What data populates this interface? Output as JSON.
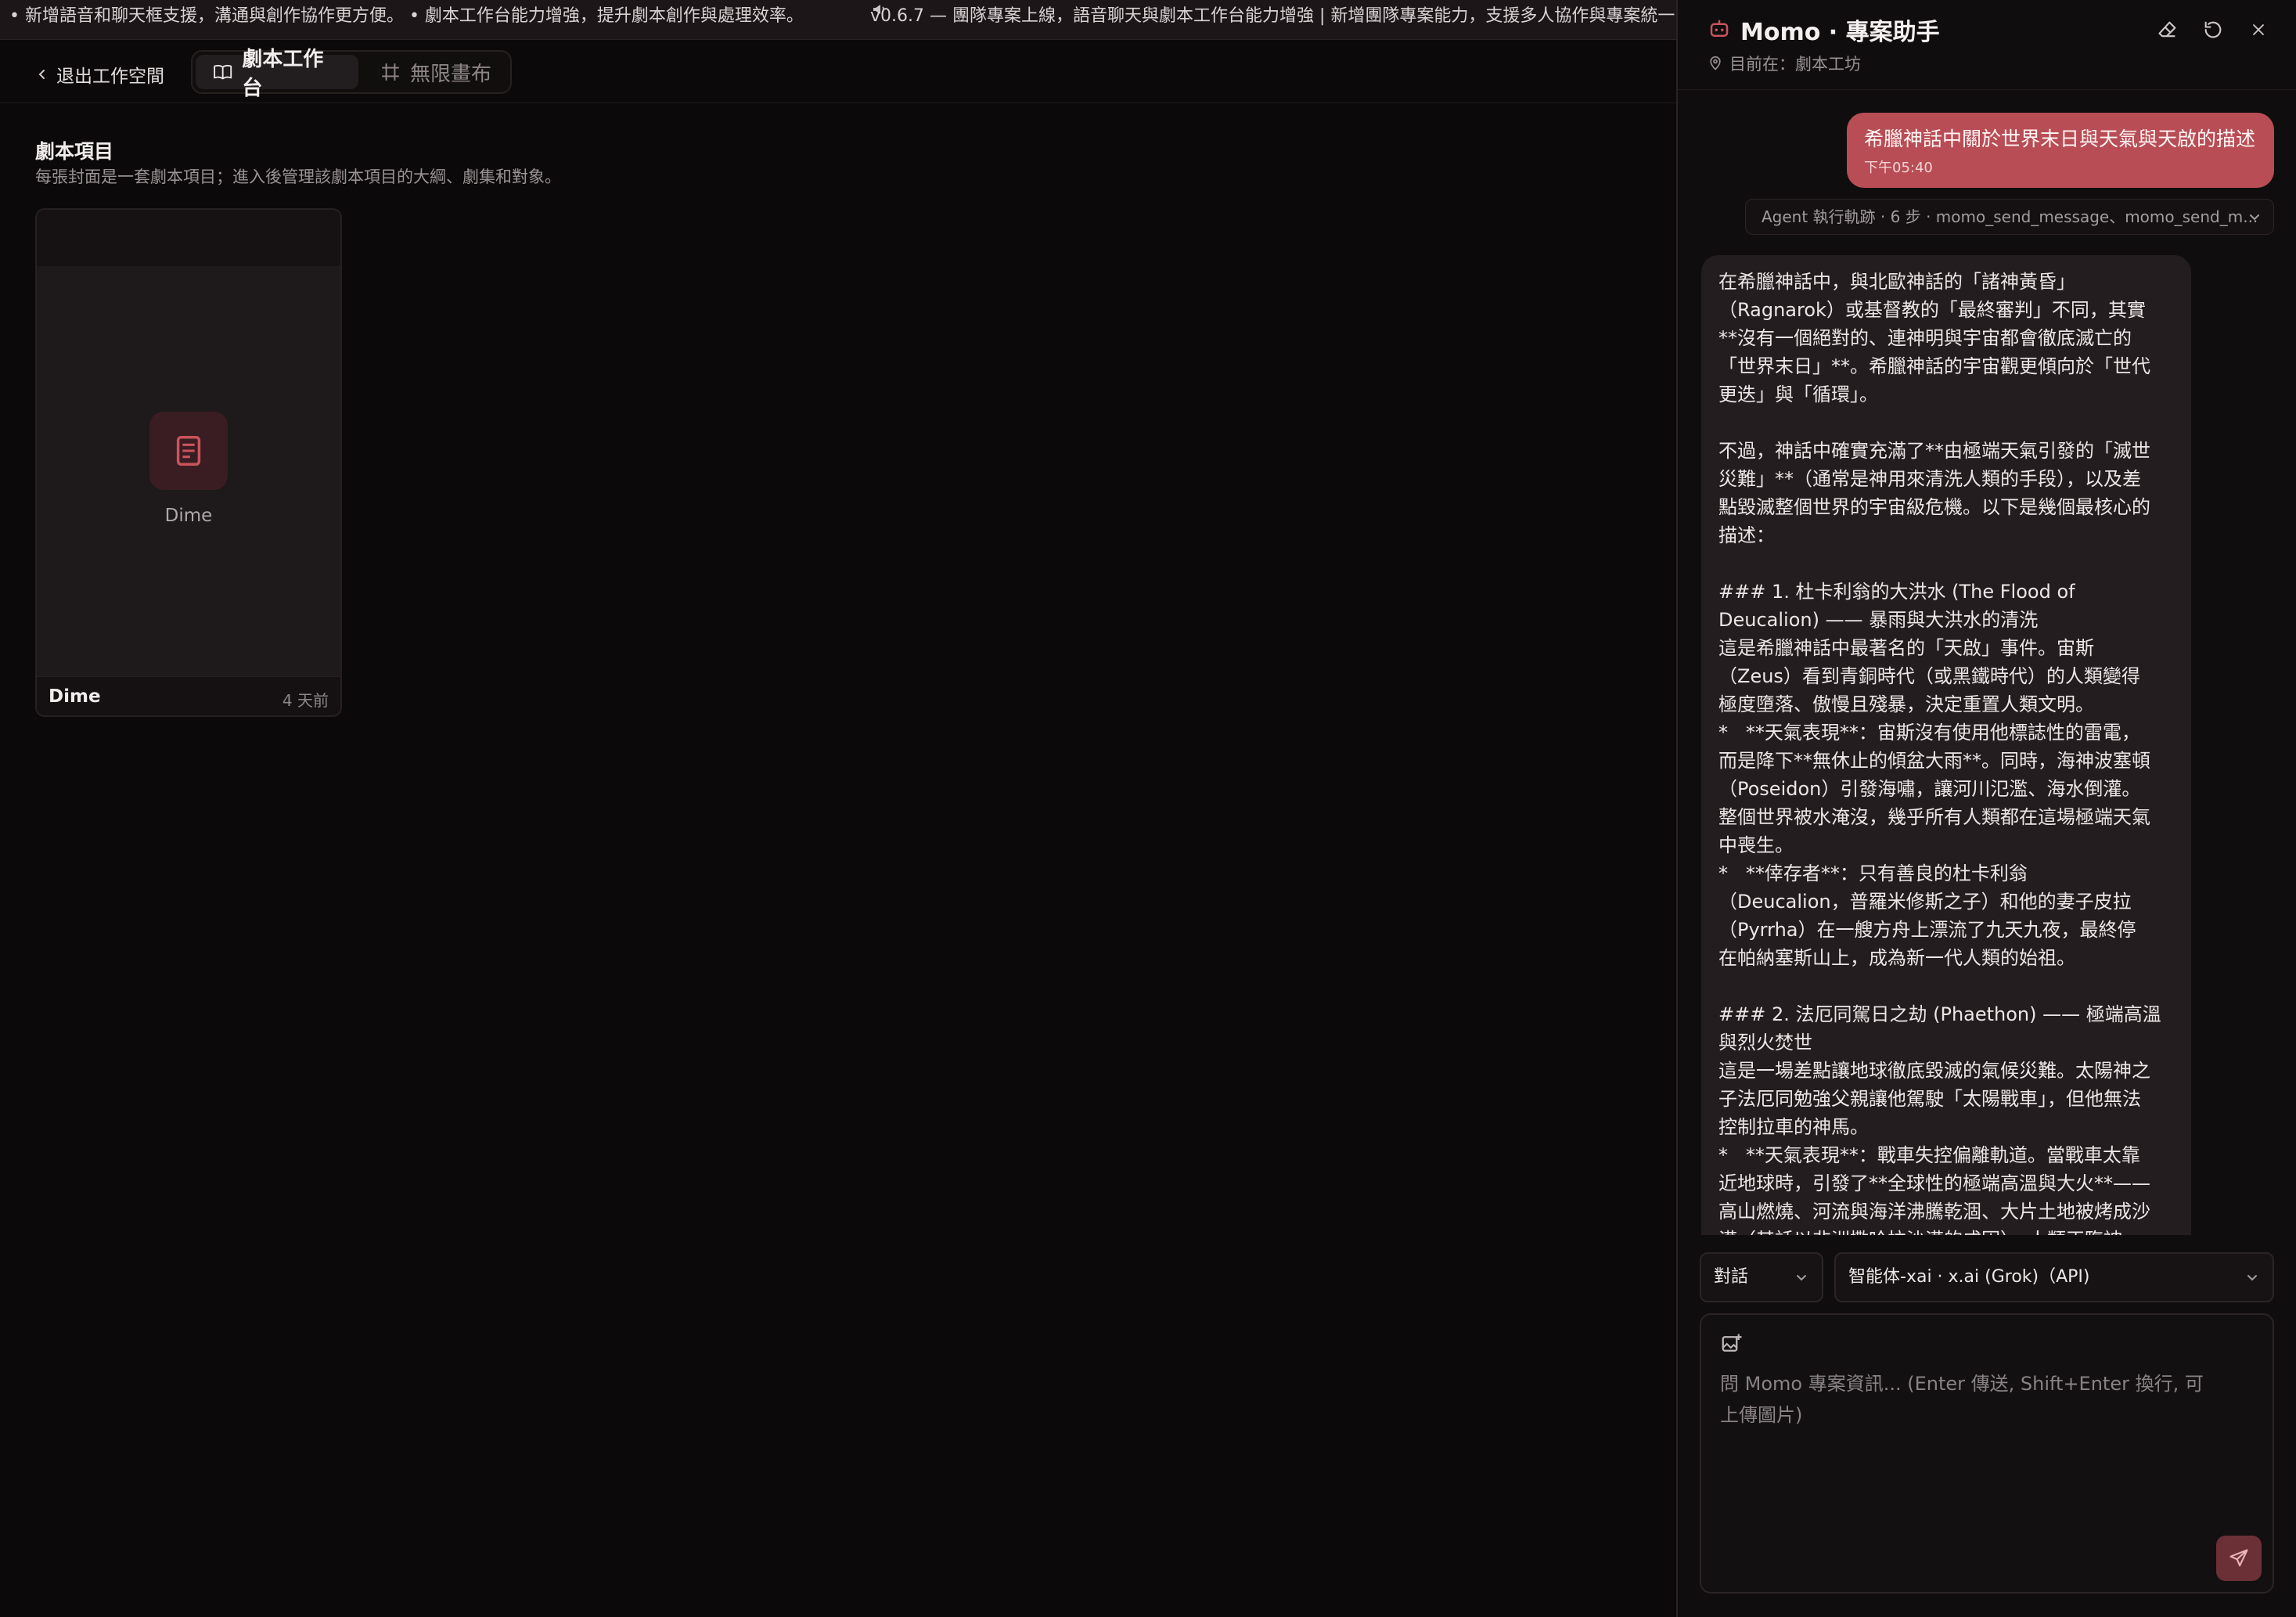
{
  "ticker": {
    "left_text": "• 新增語音和聊天框支援，溝通與創作協作更方便。 • 劇本工作台能力增強，提升劇本創作與處理效率。",
    "right_text": "v0.6.7 — 團隊專案上線，語音聊天與劇本工作台能力增強 | 新增團隊專案能力，支援多人協作與專案統一"
  },
  "nav": {
    "back_label": "退出工作空間",
    "tabs": [
      {
        "label": "劇本工作台",
        "active": true
      },
      {
        "label": "無限畫布",
        "active": false
      }
    ]
  },
  "projects": {
    "title": "劇本項目",
    "subtitle": "每張封面是一套劇本項目；進入後管理該劇本項目的大綱、劇集和對象。",
    "items": [
      {
        "cover_name": "Dime",
        "name": "Dime",
        "updated": "4 天前"
      }
    ]
  },
  "panel": {
    "title": "Momo · 專案助手",
    "location": "目前在：劇本工坊",
    "user_message": {
      "text": "希臘神話中關於世界末日與天氣與天啟的描述",
      "time": "下午05:40"
    },
    "trace_label": "Agent 執行軌跡 · 6 步 · momo_send_message、momo_send_m...",
    "bot_message": "在希臘神話中，與北歐神話的「諸神黃昏」\n（Ragnarok）或基督教的「最終審判」不同，其實\n**沒有一個絕對的、連神明與宇宙都會徹底滅亡的\n「世界末日」**。希臘神話的宇宙觀更傾向於「世代\n更迭」與「循環」。\n\n不過，神話中確實充滿了**由極端天氣引發的「滅世\n災難」**（通常是神用來清洗人類的手段），以及差\n點毀滅整個世界的宇宙級危機。以下是幾個最核心的\n描述：\n\n### 1. 杜卡利翁的大洪水 (The Flood of\nDeucalion) —— 暴雨與大洪水的清洗\n這是希臘神話中最著名的「天啟」事件。宙斯\n（Zeus）看到青銅時代（或黑鐵時代）的人類變得\n極度墮落、傲慢且殘暴，決定重置人類文明。\n*   **天氣表現**：宙斯沒有使用他標誌性的雷電，\n而是降下**無休止的傾盆大雨**。同時，海神波塞頓\n（Poseidon）引發海嘯，讓河川氾濫、海水倒灌。\n整個世界被水淹沒，幾乎所有人類都在這場極端天氣\n中喪生。\n*   **倖存者**：只有善良的杜卡利翁\n（Deucalion，普羅米修斯之子）和他的妻子皮拉\n（Pyrrha）在一艘方舟上漂流了九天九夜，最終停\n在帕納塞斯山上，成為新一代人類的始祖。\n\n### 2. 法厄同駕日之劫 (Phaethon) —— 極端高溫\n與烈火焚世\n這是一場差點讓地球徹底毀滅的氣候災難。太陽神之\n子法厄同勉強父親讓他駕駛「太陽戰車」，但他無法\n控制拉車的神馬。\n*   **天氣表現**：戰車失控偏離軌道。當戰車太靠\n近地球時，引發了**全球性的極端高溫與大火**——\n高山燃燒、河流與海洋沸騰乾涸、大片土地被烤成沙\n漠（其話以非洲撒哈拉沙漠的成因）。人類正臨被",
    "mode_select": "對話",
    "model_select": "智能体-xai · x.ai (Grok)（API)",
    "input_placeholder": "問 Momo 專案資訊... (Enter 傳送, Shift+Enter 換行, 可上傳圖片)"
  },
  "colors": {
    "accent": "#b84d55",
    "background": "#0b0909",
    "panel": "#100d0e"
  }
}
